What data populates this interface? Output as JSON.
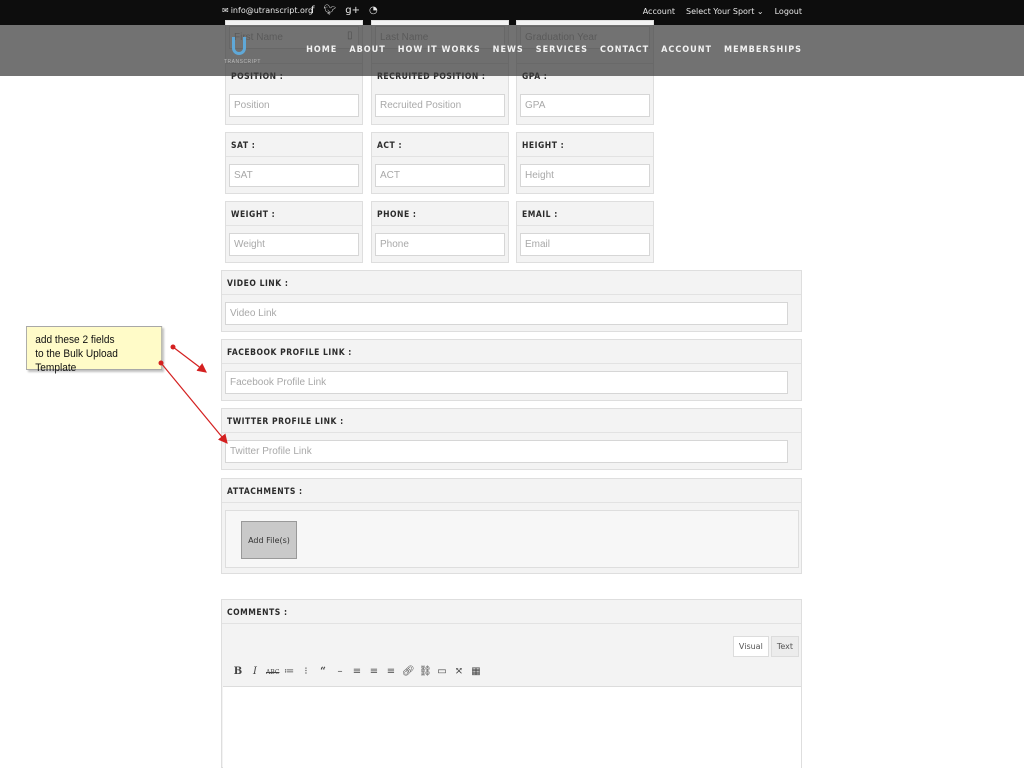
{
  "topbar": {
    "email": "info@utranscript.org",
    "social_icons": [
      "facebook-icon",
      "twitter-icon",
      "google-plus-icon",
      "rss-icon"
    ],
    "account": "Account",
    "sport_select": "Select Your Sport",
    "logout": "Logout"
  },
  "nav": {
    "logo_text": "TRANSCRIPT",
    "items": [
      "HOME",
      "ABOUT",
      "HOW IT WORKS",
      "NEWS",
      "SERVICES",
      "CONTACT",
      "ACCOUNT",
      "MEMBERSHIPS"
    ]
  },
  "form": {
    "row0": {
      "first_name_placeholder": "First Name",
      "last_name_placeholder": "Last Name",
      "grad_year_placeholder": "Graduation Year"
    },
    "row1": [
      {
        "label": "POSITION :",
        "placeholder": "Position"
      },
      {
        "label": "RECRUITED POSITION :",
        "placeholder": "Recruited Position"
      },
      {
        "label": "GPA :",
        "placeholder": "GPA"
      }
    ],
    "row2": [
      {
        "label": "SAT :",
        "placeholder": "SAT"
      },
      {
        "label": "ACT :",
        "placeholder": "ACT"
      },
      {
        "label": "HEIGHT :",
        "placeholder": "Height"
      }
    ],
    "row3": [
      {
        "label": "WEIGHT :",
        "placeholder": "Weight"
      },
      {
        "label": "PHONE :",
        "placeholder": "Phone"
      },
      {
        "label": "EMAIL :",
        "placeholder": "Email"
      }
    ],
    "video": {
      "label": "VIDEO LINK :",
      "placeholder": "Video Link"
    },
    "facebook": {
      "label": "FACEBOOK PROFILE LINK :",
      "placeholder": "Facebook Profile Link"
    },
    "twitter": {
      "label": "TWITTER PROFILE LINK :",
      "placeholder": "Twitter Profile Link"
    },
    "attachments": {
      "label": "ATTACHMENTS :",
      "button": "Add File(s)"
    },
    "comments": {
      "label": "COMMENTS :",
      "tab_visual": "Visual",
      "tab_text": "Text",
      "toolbar": [
        "bold-icon",
        "italic-icon",
        "strikethrough-icon",
        "bullet-list-icon",
        "numbered-list-icon",
        "blockquote-icon",
        "horizontal-rule-icon",
        "align-left-icon",
        "align-center-icon",
        "align-right-icon",
        "link-icon",
        "unlink-icon",
        "read-more-icon",
        "fullscreen-icon",
        "toolbar-toggle-icon"
      ]
    }
  },
  "annotation": {
    "line1": "add these 2 fields",
    "line2": "to the Bulk Upload Template",
    "color": "#d42020"
  }
}
